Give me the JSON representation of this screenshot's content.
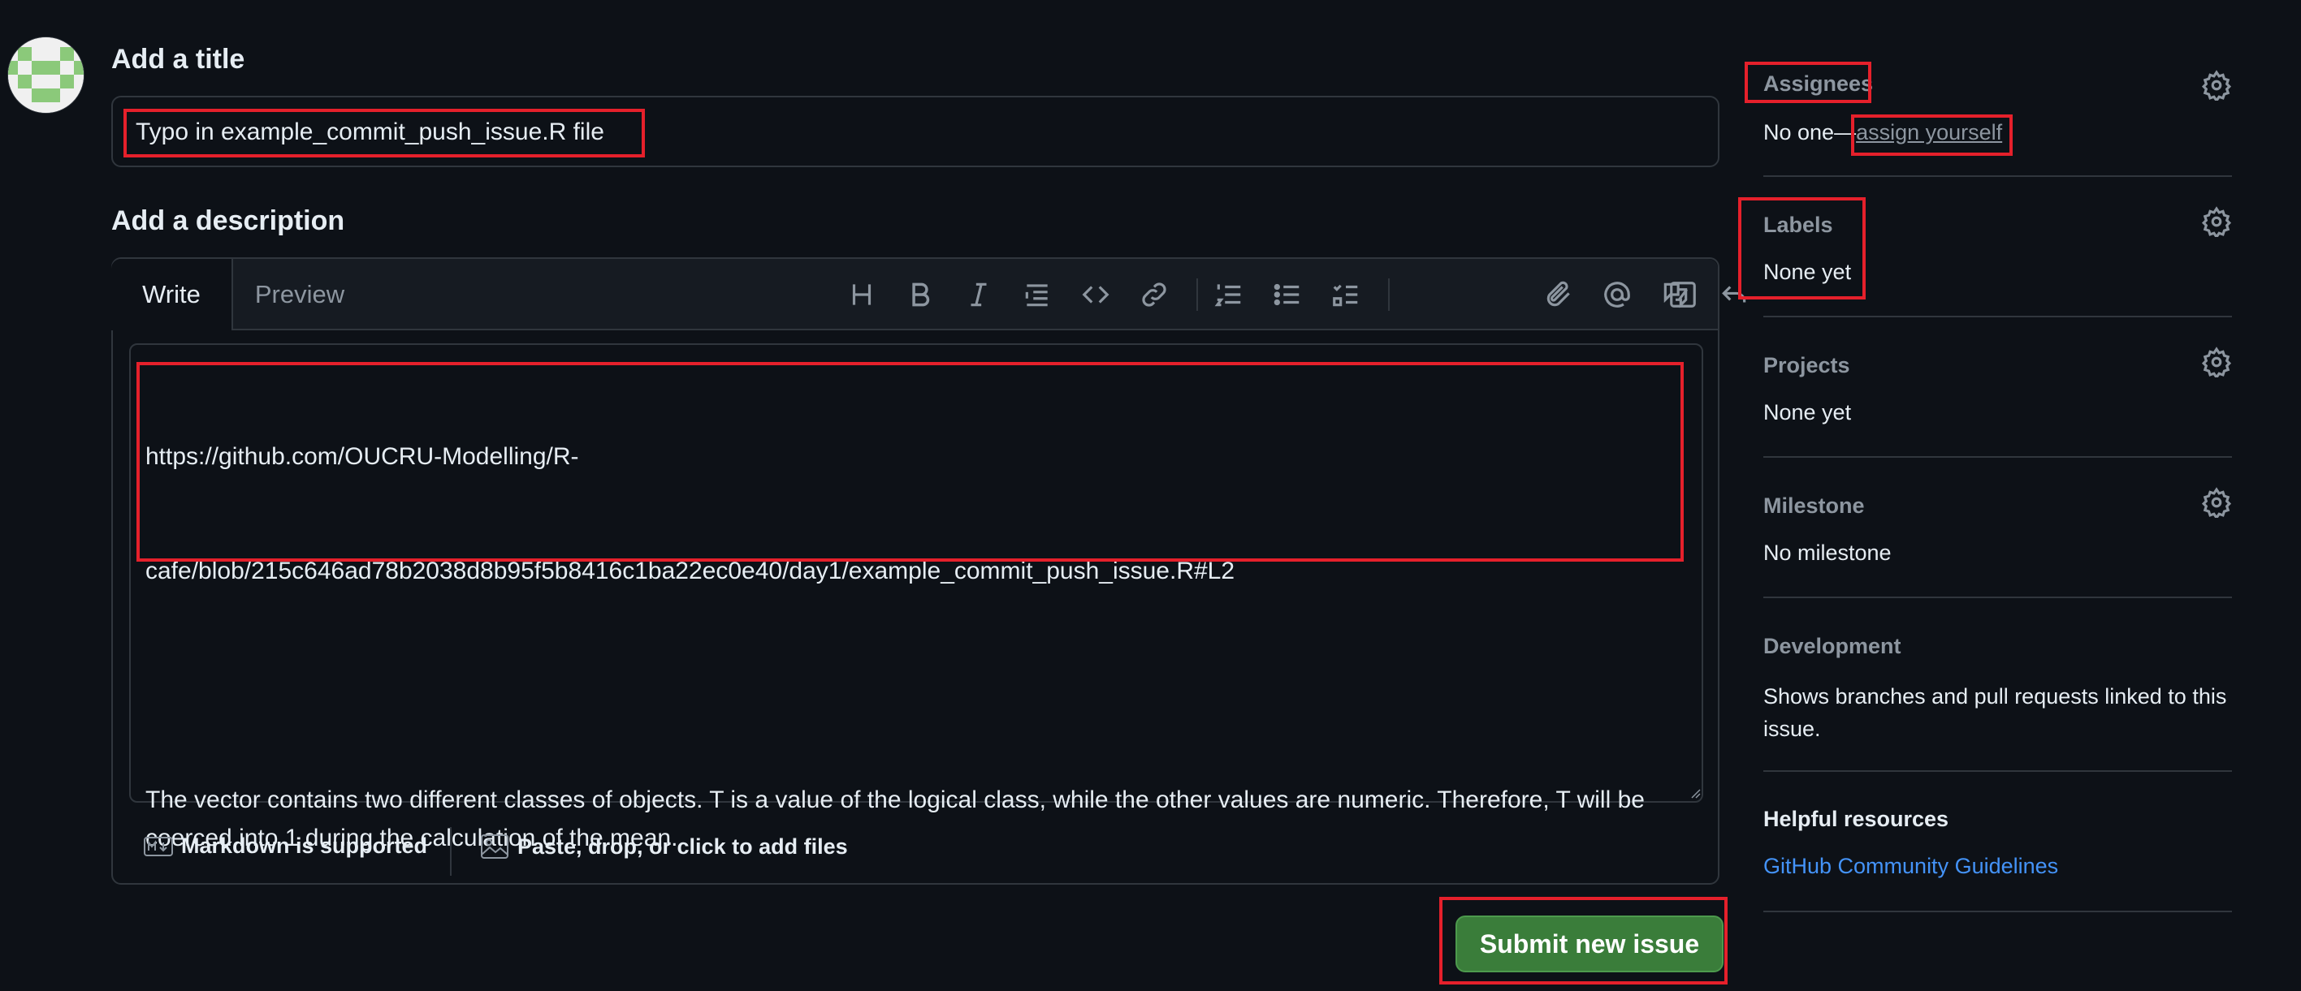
{
  "title_section": {
    "heading": "Add a title",
    "input_value": "Typo in example_commit_push_issue.R file"
  },
  "description_section": {
    "heading": "Add a description",
    "tabs": [
      {
        "label": "Write",
        "active": true
      },
      {
        "label": "Preview",
        "active": false
      }
    ],
    "toolbar": [
      {
        "name": "heading-icon"
      },
      {
        "name": "bold-icon"
      },
      {
        "name": "italic-icon"
      },
      {
        "name": "quote-icon"
      },
      {
        "name": "code-icon"
      },
      {
        "name": "link-icon"
      },
      {
        "name": "ordered-list-icon"
      },
      {
        "name": "unordered-list-icon"
      },
      {
        "name": "task-list-icon"
      },
      {
        "name": "attach-icon"
      },
      {
        "name": "mention-icon"
      },
      {
        "name": "cross-reference-icon"
      },
      {
        "name": "reply-icon"
      },
      {
        "name": "slash-commands-icon"
      }
    ],
    "body_line1": "https://github.com/OUCRU-Modelling/R-",
    "body_line2": "cafe/blob/215c646ad78b2038d8b95f5b8416c1ba22ec0e40/day1/example_commit_push_issue.R#L2",
    "body_paragraph": "The vector contains two different classes of objects. T is a value of the logical class, while the other values are numeric. Therefore, T will be coerced into 1 during the calculation of the mean.",
    "footer": {
      "markdown_label": "Markdown is supported",
      "files_label": "Paste, drop, or click to add files"
    }
  },
  "submit_label": "Submit new issue",
  "sidebar": {
    "assignees": {
      "label": "Assignees",
      "value": "No one—",
      "link": "assign yourself"
    },
    "labels": {
      "label": "Labels",
      "value": "None yet"
    },
    "projects": {
      "label": "Projects",
      "value": "None yet"
    },
    "milestone": {
      "label": "Milestone",
      "value": "No milestone"
    },
    "development": {
      "label": "Development",
      "value_line1": "Shows branches and pull requests linked to this",
      "value_line2": "issue."
    },
    "helpful": {
      "label": "Helpful resources",
      "link": "GitHub Community Guidelines"
    }
  },
  "colors": {
    "background": "#0d1117",
    "border": "#30363d",
    "submit_green": "#3a7d3a",
    "highlight_red": "#e5202b",
    "link_blue": "#4493f8"
  }
}
